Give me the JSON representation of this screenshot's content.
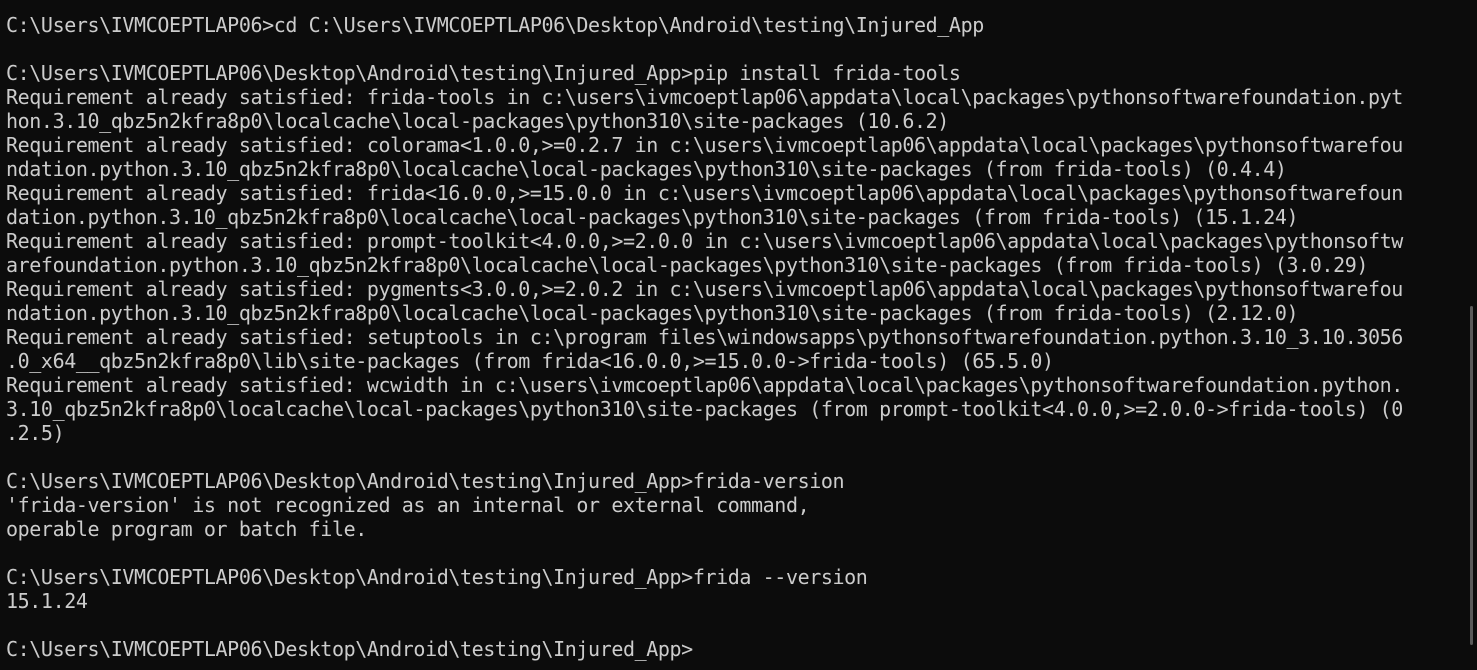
{
  "terminal": {
    "lines": [
      "C:\\Users\\IVMCOEPTLAP06>cd C:\\Users\\IVMCOEPTLAP06\\Desktop\\Android\\testing\\Injured_App",
      "",
      "C:\\Users\\IVMCOEPTLAP06\\Desktop\\Android\\testing\\Injured_App>pip install frida-tools",
      "Requirement already satisfied: frida-tools in c:\\users\\ivmcoeptlap06\\appdata\\local\\packages\\pythonsoftwarefoundation.pyt",
      "hon.3.10_qbz5n2kfra8p0\\localcache\\local-packages\\python310\\site-packages (10.6.2)",
      "Requirement already satisfied: colorama<1.0.0,>=0.2.7 in c:\\users\\ivmcoeptlap06\\appdata\\local\\packages\\pythonsoftwarefou",
      "ndation.python.3.10_qbz5n2kfra8p0\\localcache\\local-packages\\python310\\site-packages (from frida-tools) (0.4.4)",
      "Requirement already satisfied: frida<16.0.0,>=15.0.0 in c:\\users\\ivmcoeptlap06\\appdata\\local\\packages\\pythonsoftwarefoun",
      "dation.python.3.10_qbz5n2kfra8p0\\localcache\\local-packages\\python310\\site-packages (from frida-tools) (15.1.24)",
      "Requirement already satisfied: prompt-toolkit<4.0.0,>=2.0.0 in c:\\users\\ivmcoeptlap06\\appdata\\local\\packages\\pythonsoftw",
      "arefoundation.python.3.10_qbz5n2kfra8p0\\localcache\\local-packages\\python310\\site-packages (from frida-tools) (3.0.29)",
      "Requirement already satisfied: pygments<3.0.0,>=2.0.2 in c:\\users\\ivmcoeptlap06\\appdata\\local\\packages\\pythonsoftwarefou",
      "ndation.python.3.10_qbz5n2kfra8p0\\localcache\\local-packages\\python310\\site-packages (from frida-tools) (2.12.0)",
      "Requirement already satisfied: setuptools in c:\\program files\\windowsapps\\pythonsoftwarefoundation.python.3.10_3.10.3056",
      ".0_x64__qbz5n2kfra8p0\\lib\\site-packages (from frida<16.0.0,>=15.0.0->frida-tools) (65.5.0)",
      "Requirement already satisfied: wcwidth in c:\\users\\ivmcoeptlap06\\appdata\\local\\packages\\pythonsoftwarefoundation.python.",
      "3.10_qbz5n2kfra8p0\\localcache\\local-packages\\python310\\site-packages (from prompt-toolkit<4.0.0,>=2.0.0->frida-tools) (0",
      ".2.5)",
      "",
      "C:\\Users\\IVMCOEPTLAP06\\Desktop\\Android\\testing\\Injured_App>frida-version",
      "'frida-version' is not recognized as an internal or external command,",
      "operable program or batch file.",
      "",
      "C:\\Users\\IVMCOEPTLAP06\\Desktop\\Android\\testing\\Injured_App>frida --version",
      "15.1.24",
      "",
      "C:\\Users\\IVMCOEPTLAP06\\Desktop\\Android\\testing\\Injured_App>"
    ]
  },
  "colors": {
    "background": "#0c0c0c",
    "foreground": "#cccccc"
  }
}
